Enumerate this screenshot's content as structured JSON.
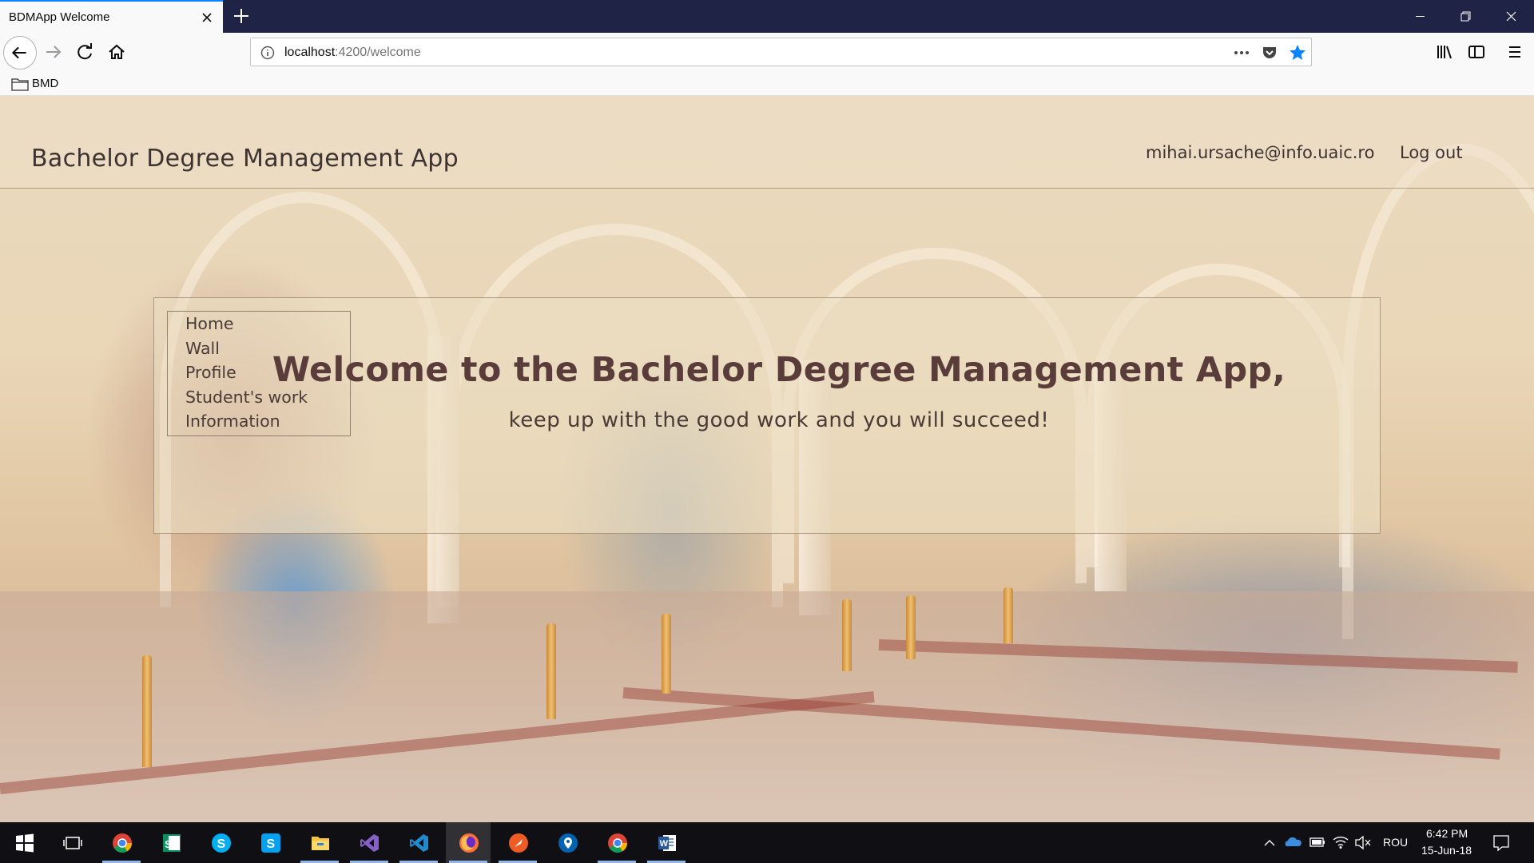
{
  "browser": {
    "tab_title": "BDMApp Welcome",
    "url_host": "localhost",
    "url_path": ":4200/welcome",
    "bookmark_folder": "BMD"
  },
  "header": {
    "title": "Bachelor Degree Management App",
    "user_email": "mihai.ursache@info.uaic.ro",
    "logout_label": "Log out"
  },
  "sidebar": {
    "items": [
      {
        "label": "Home"
      },
      {
        "label": "Wall"
      },
      {
        "label": "Profile"
      },
      {
        "label": "Student's work"
      },
      {
        "label": "Information"
      }
    ]
  },
  "welcome": {
    "heading": "Welcome to the Bachelor Degree Management App,",
    "subheading": "keep up with the good work and you will succeed!"
  },
  "taskbar": {
    "apps": [
      "start-icon",
      "task-view-icon",
      "chrome-icon",
      "sway-icon",
      "skype-icon",
      "skype-for-business-icon",
      "file-explorer-icon",
      "visual-studio-icon",
      "vscode-icon",
      "firefox-icon",
      "postman-icon",
      "maps-icon",
      "chrome-icon",
      "word-icon"
    ],
    "language": "ROU",
    "time": "6:42 PM",
    "date": "15-Jun-18"
  },
  "colors": {
    "tabbar": "#1f2345",
    "accent": "#0a84ff",
    "text_dark": "#3d3330",
    "heading": "#5a3c3a"
  }
}
